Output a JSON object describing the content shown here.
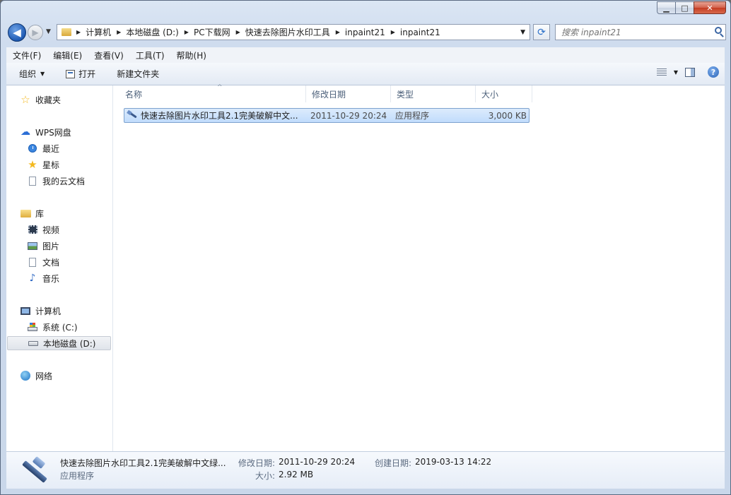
{
  "window": {
    "min_label": "▁",
    "max_label": "□",
    "close_label": "✕"
  },
  "nav": {
    "back_label": "◀",
    "forward_label": "▶",
    "dropdown_label": "▼"
  },
  "address": {
    "crumbs": [
      "计算机",
      "本地磁盘 (D:)",
      "PC下载网",
      "快速去除图片水印工具",
      "inpaint21",
      "inpaint21"
    ]
  },
  "search": {
    "placeholder": "搜索 inpaint21"
  },
  "menu": [
    "文件(F)",
    "编辑(E)",
    "查看(V)",
    "工具(T)",
    "帮助(H)"
  ],
  "commands": {
    "organize": "组织",
    "open": "打开",
    "new_folder": "新建文件夹"
  },
  "sidebar": {
    "favorites": "收藏夹",
    "wps": {
      "title": "WPS网盘",
      "items": [
        "最近",
        "星标",
        "我的云文档"
      ]
    },
    "library": {
      "title": "库",
      "items": [
        "视频",
        "图片",
        "文档",
        "音乐"
      ]
    },
    "computer": {
      "title": "计算机",
      "items": [
        "系统 (C:)",
        "本地磁盘 (D:)"
      ]
    },
    "network": "网络"
  },
  "columns": [
    "名称",
    "修改日期",
    "类型",
    "大小"
  ],
  "files": [
    {
      "name": "快速去除图片水印工具2.1完美破解中文...",
      "modified": "2011-10-29 20:24",
      "type": "应用程序",
      "size": "3,000 KB",
      "selected": true
    }
  ],
  "details": {
    "name": "快速去除图片水印工具2.1完美破解中文绿...",
    "type": "应用程序",
    "modified_label": "修改日期:",
    "modified_value": "2011-10-29 20:24",
    "created_label": "创建日期:",
    "created_value": "2019-03-13 14:22",
    "size_label": "大小:",
    "size_value": "2.92 MB"
  }
}
